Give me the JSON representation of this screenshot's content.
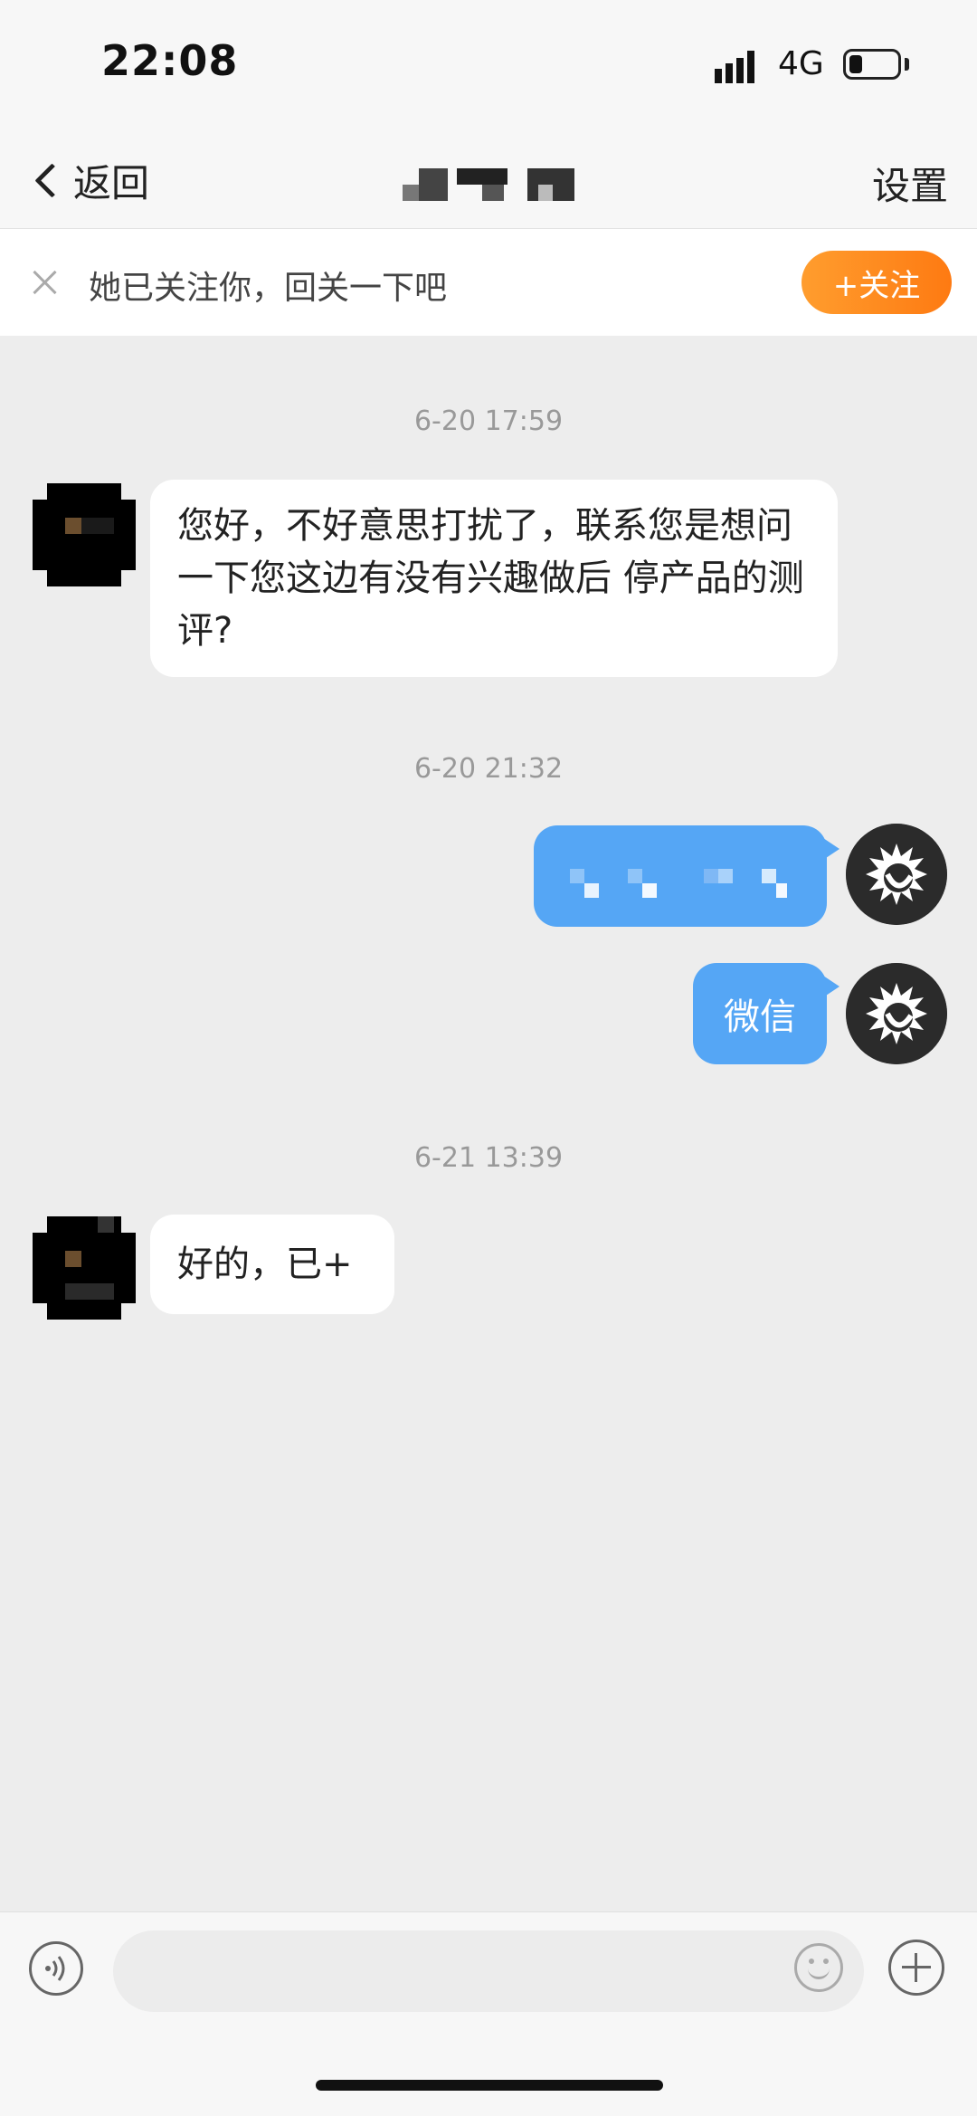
{
  "status_bar": {
    "time": "22:08",
    "network": "4G"
  },
  "nav": {
    "back_label": "返回",
    "settings_label": "设置"
  },
  "follow_banner": {
    "text": "她已关注你，回关一下吧",
    "button_label": "+关注",
    "accent": "#fe8a1a"
  },
  "messages": [
    {
      "type": "timestamp",
      "text": "6-20 17:59"
    },
    {
      "type": "incoming",
      "text": "您好，不好意思打扰了，联系您是想问一下您这边有没有兴趣做后 停产品的测评?"
    },
    {
      "type": "timestamp",
      "text": "6-20 21:32"
    },
    {
      "type": "outgoing",
      "text": ""
    },
    {
      "type": "outgoing",
      "text": "微信"
    },
    {
      "type": "timestamp",
      "text": "6-21 13:39"
    },
    {
      "type": "incoming",
      "text": "好的，已+"
    }
  ],
  "input": {
    "placeholder": ""
  },
  "colors": {
    "outgoing_bubble": "#55a6f5",
    "background": "#ededed"
  }
}
